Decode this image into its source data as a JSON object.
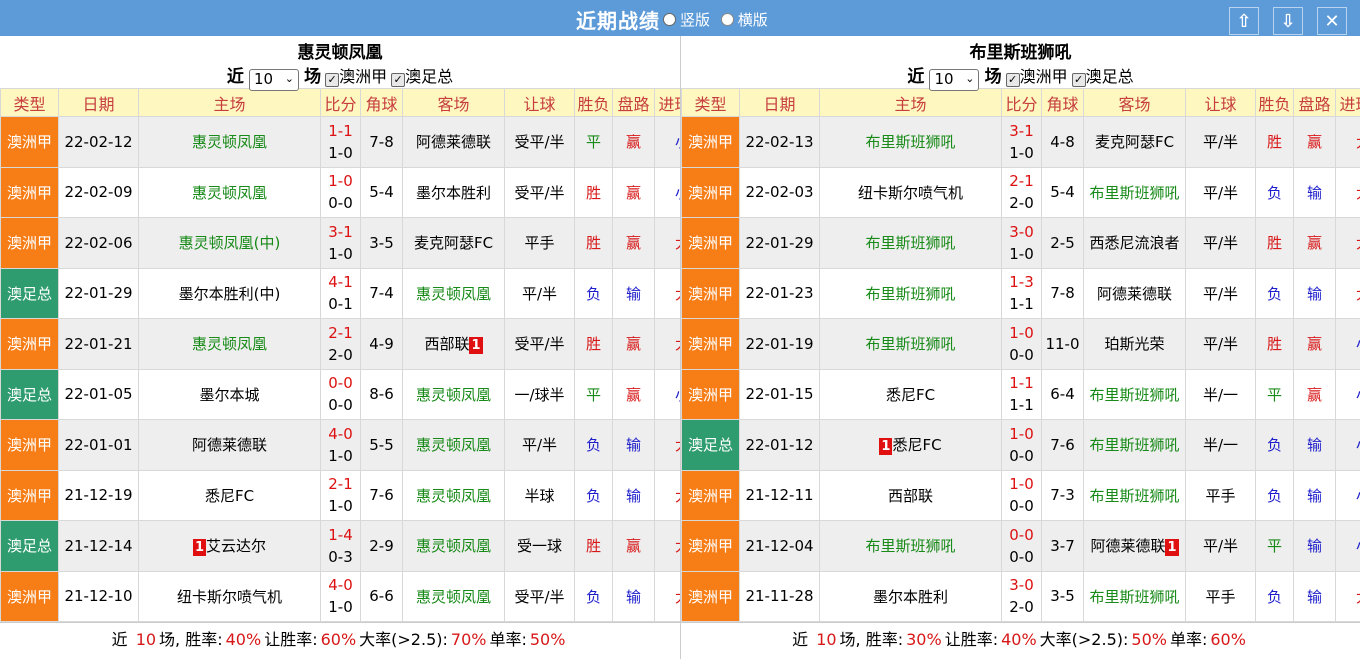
{
  "title": "近期战绩",
  "view_options": [
    "竖版",
    "横版"
  ],
  "buttons": {
    "up": "🡅",
    "down": "🡇",
    "close": "✕"
  },
  "headers": [
    "类型",
    "日期",
    "主场",
    "比分",
    "角球",
    "客场",
    "让球",
    "胜负",
    "盘路",
    "进球数"
  ],
  "controls": {
    "prefix": "近",
    "count": "10",
    "suffix": "场",
    "filter1": "澳洲甲",
    "filter2": "澳足总"
  },
  "left": {
    "team": "惠灵顿凤凰",
    "rows": [
      {
        "type": "澳洲甲",
        "date": "22-02-12",
        "home": "惠灵顿凤凰",
        "score": "1-1",
        "half": "1-0",
        "corner": "7-8",
        "away": "阿德莱德联",
        "hcp": "受平/半",
        "result": "平",
        "pan": "赢",
        "goals": "小"
      },
      {
        "type": "澳洲甲",
        "date": "22-02-09",
        "home": "惠灵顿凤凰",
        "score": "1-0",
        "half": "0-0",
        "corner": "5-4",
        "away": "墨尔本胜利",
        "hcp": "受平/半",
        "result": "胜",
        "pan": "赢",
        "goals": "小"
      },
      {
        "type": "澳洲甲",
        "date": "22-02-06",
        "home": "惠灵顿凤凰(中)",
        "score": "3-1",
        "half": "1-0",
        "corner": "3-5",
        "away": "麦克阿瑟FC",
        "hcp": "平手",
        "result": "胜",
        "pan": "赢",
        "goals": "大"
      },
      {
        "type": "澳足总",
        "date": "22-01-29",
        "home": "墨尔本胜利(中)",
        "score": "4-1",
        "half": "0-1",
        "corner": "7-4",
        "away": "惠灵顿凤凰",
        "hcp": "平/半",
        "result": "负",
        "pan": "输",
        "goals": "大"
      },
      {
        "type": "澳洲甲",
        "date": "22-01-21",
        "home": "惠灵顿凤凰",
        "score": "2-1",
        "half": "2-0",
        "corner": "4-9",
        "away": "西部联",
        "away_card": "1",
        "hcp": "受平/半",
        "result": "胜",
        "pan": "赢",
        "goals": "大"
      },
      {
        "type": "澳足总",
        "date": "22-01-05",
        "home": "墨尔本城",
        "score": "0-0",
        "half": "0-0",
        "corner": "8-6",
        "away": "惠灵顿凤凰",
        "hcp": "一/球半",
        "result": "平",
        "pan": "赢",
        "goals": "小"
      },
      {
        "type": "澳洲甲",
        "date": "22-01-01",
        "home": "阿德莱德联",
        "score": "4-0",
        "half": "1-0",
        "corner": "5-5",
        "away": "惠灵顿凤凰",
        "hcp": "平/半",
        "result": "负",
        "pan": "输",
        "goals": "大"
      },
      {
        "type": "澳洲甲",
        "date": "21-12-19",
        "home": "悉尼FC",
        "score": "2-1",
        "half": "1-0",
        "corner": "7-6",
        "away": "惠灵顿凤凰",
        "hcp": "半球",
        "result": "负",
        "pan": "输",
        "goals": "大"
      },
      {
        "type": "澳足总",
        "date": "21-12-14",
        "home_card": "1",
        "home": "艾云达尔",
        "score": "1-4",
        "half": "0-3",
        "corner": "2-9",
        "away": "惠灵顿凤凰",
        "hcp": "受一球",
        "result": "胜",
        "pan": "赢",
        "goals": "大"
      },
      {
        "type": "澳洲甲",
        "date": "21-12-10",
        "home": "纽卡斯尔喷气机",
        "score": "4-0",
        "half": "1-0",
        "corner": "6-6",
        "away": "惠灵顿凤凰",
        "hcp": "受平/半",
        "result": "负",
        "pan": "输",
        "goals": "大"
      }
    ],
    "summary": {
      "pre": "近",
      "n": "10",
      "mid": "场, 胜率:",
      "win": "40%",
      "l2": "让胜率:",
      "hwin": "60%",
      "l3": "大率(>2.5):",
      "big": "70%",
      "l4": "单率:",
      "odd": "50%"
    }
  },
  "right": {
    "team": "布里斯班狮吼",
    "rows": [
      {
        "type": "澳洲甲",
        "date": "22-02-13",
        "home": "布里斯班狮吼",
        "score": "3-1",
        "half": "1-0",
        "corner": "4-8",
        "away": "麦克阿瑟FC",
        "hcp": "平/半",
        "result": "胜",
        "pan": "赢",
        "goals": "大"
      },
      {
        "type": "澳洲甲",
        "date": "22-02-03",
        "home": "纽卡斯尔喷气机",
        "score": "2-1",
        "half": "2-0",
        "corner": "5-4",
        "away": "布里斯班狮吼",
        "hcp": "平/半",
        "result": "负",
        "pan": "输",
        "goals": "大"
      },
      {
        "type": "澳洲甲",
        "date": "22-01-29",
        "home": "布里斯班狮吼",
        "score": "3-0",
        "half": "1-0",
        "corner": "2-5",
        "away": "西悉尼流浪者",
        "hcp": "平/半",
        "result": "胜",
        "pan": "赢",
        "goals": "大"
      },
      {
        "type": "澳洲甲",
        "date": "22-01-23",
        "home": "布里斯班狮吼",
        "score": "1-3",
        "half": "1-1",
        "corner": "7-8",
        "away": "阿德莱德联",
        "hcp": "平/半",
        "result": "负",
        "pan": "输",
        "goals": "大"
      },
      {
        "type": "澳洲甲",
        "date": "22-01-19",
        "home": "布里斯班狮吼",
        "score": "1-0",
        "half": "0-0",
        "corner": "11-0",
        "away": "珀斯光荣",
        "hcp": "平/半",
        "result": "胜",
        "pan": "赢",
        "goals": "小"
      },
      {
        "type": "澳洲甲",
        "date": "22-01-15",
        "home": "悉尼FC",
        "score": "1-1",
        "half": "1-1",
        "corner": "6-4",
        "away": "布里斯班狮吼",
        "hcp": "半/一",
        "result": "平",
        "pan": "赢",
        "goals": "小"
      },
      {
        "type": "澳足总",
        "date": "22-01-12",
        "home_card": "1",
        "home": "悉尼FC",
        "score": "1-0",
        "half": "0-0",
        "corner": "7-6",
        "away": "布里斯班狮吼",
        "hcp": "半/一",
        "result": "负",
        "pan": "输",
        "goals": "小"
      },
      {
        "type": "澳洲甲",
        "date": "21-12-11",
        "home": "西部联",
        "score": "1-0",
        "half": "0-0",
        "corner": "7-3",
        "away": "布里斯班狮吼",
        "hcp": "平手",
        "result": "负",
        "pan": "输",
        "goals": "小"
      },
      {
        "type": "澳洲甲",
        "date": "21-12-04",
        "home": "布里斯班狮吼",
        "score": "0-0",
        "half": "0-0",
        "corner": "3-7",
        "away": "阿德莱德联",
        "away_card": "1",
        "hcp": "平/半",
        "result": "平",
        "pan": "输",
        "goals": "小"
      },
      {
        "type": "澳洲甲",
        "date": "21-11-28",
        "home": "墨尔本胜利",
        "score": "3-0",
        "half": "2-0",
        "corner": "3-5",
        "away": "布里斯班狮吼",
        "hcp": "平手",
        "result": "负",
        "pan": "输",
        "goals": "大"
      }
    ],
    "summary": {
      "pre": "近",
      "n": "10",
      "mid": "场, 胜率:",
      "win": "30%",
      "l2": "让胜率:",
      "hwin": "40%",
      "l3": "大率(>2.5):",
      "big": "50%",
      "l4": "单率:",
      "odd": "60%"
    }
  }
}
